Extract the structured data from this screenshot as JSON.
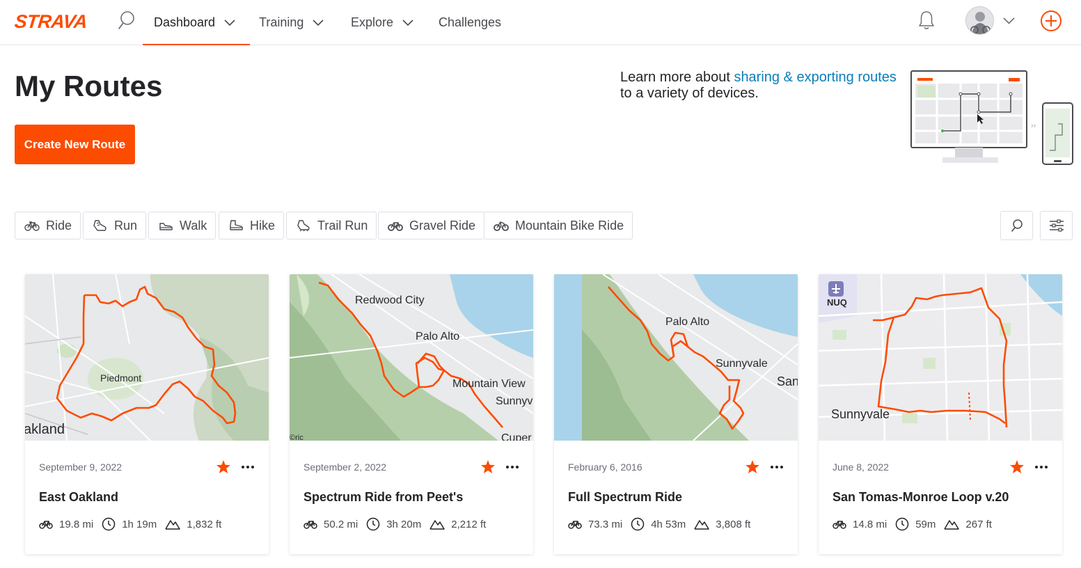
{
  "nav": {
    "brand": "STRAVA",
    "items": [
      {
        "label": "Dashboard",
        "dropdown": true,
        "active": true
      },
      {
        "label": "Training",
        "dropdown": true
      },
      {
        "label": "Explore",
        "dropdown": true
      },
      {
        "label": "Challenges",
        "dropdown": false
      }
    ],
    "icons": [
      "search-icon",
      "bell-icon",
      "avatar",
      "chevron-down-icon",
      "plus-circle-icon"
    ],
    "accent": "#fc4c02"
  },
  "header": {
    "title": "My Routes",
    "create_label": "Create New Route",
    "learn_prefix": "Learn more about ",
    "learn_link": "sharing & exporting routes",
    "learn_suffix": "to a variety of devices.",
    "link_color": "#0a7eb8"
  },
  "filters": [
    {
      "label": "Ride",
      "icon": "bike-icon"
    },
    {
      "label": "Run",
      "icon": "run-shoe-icon"
    },
    {
      "label": "Walk",
      "icon": "walk-shoe-icon"
    },
    {
      "label": "Hike",
      "icon": "hike-boot-icon"
    },
    {
      "label": "Trail Run",
      "icon": "trail-shoe-icon"
    },
    {
      "label": "Gravel Ride",
      "icon": "gravel-bike-icon"
    },
    {
      "label": "Mountain Bike Ride",
      "icon": "mountain-bike-icon"
    }
  ],
  "tools": [
    "search-icon",
    "filter-sliders-icon"
  ],
  "routes": [
    {
      "date": "September 9, 2022",
      "title": "East Oakland",
      "distance": "19.8 mi",
      "time": "1h 19m",
      "elevation": "1,832 ft",
      "starred": true,
      "map_labels": [
        "Piedmont",
        "akland"
      ]
    },
    {
      "date": "September 2, 2022",
      "title": "Spectrum Ride from Peet's",
      "distance": "50.2 mi",
      "time": "3h 20m",
      "elevation": "2,212 ft",
      "starred": true,
      "map_labels": [
        "Redwood City",
        "Palo Alto",
        "Mountain View",
        "Sunnyv",
        "Cuper",
        "©ric"
      ]
    },
    {
      "date": "February 6, 2016",
      "title": "Full Spectrum Ride",
      "distance": "73.3 mi",
      "time": "4h 53m",
      "elevation": "3,808 ft",
      "starred": true,
      "map_labels": [
        "Palo Alto",
        "Sunnyvale",
        "San"
      ]
    },
    {
      "date": "June 8, 2022",
      "title": "San Tomas-Monroe Loop v.20",
      "distance": "14.8 mi",
      "time": "59m",
      "elevation": "267 ft",
      "starred": true,
      "map_labels": [
        "NUQ",
        "Sunnyvale"
      ]
    }
  ]
}
